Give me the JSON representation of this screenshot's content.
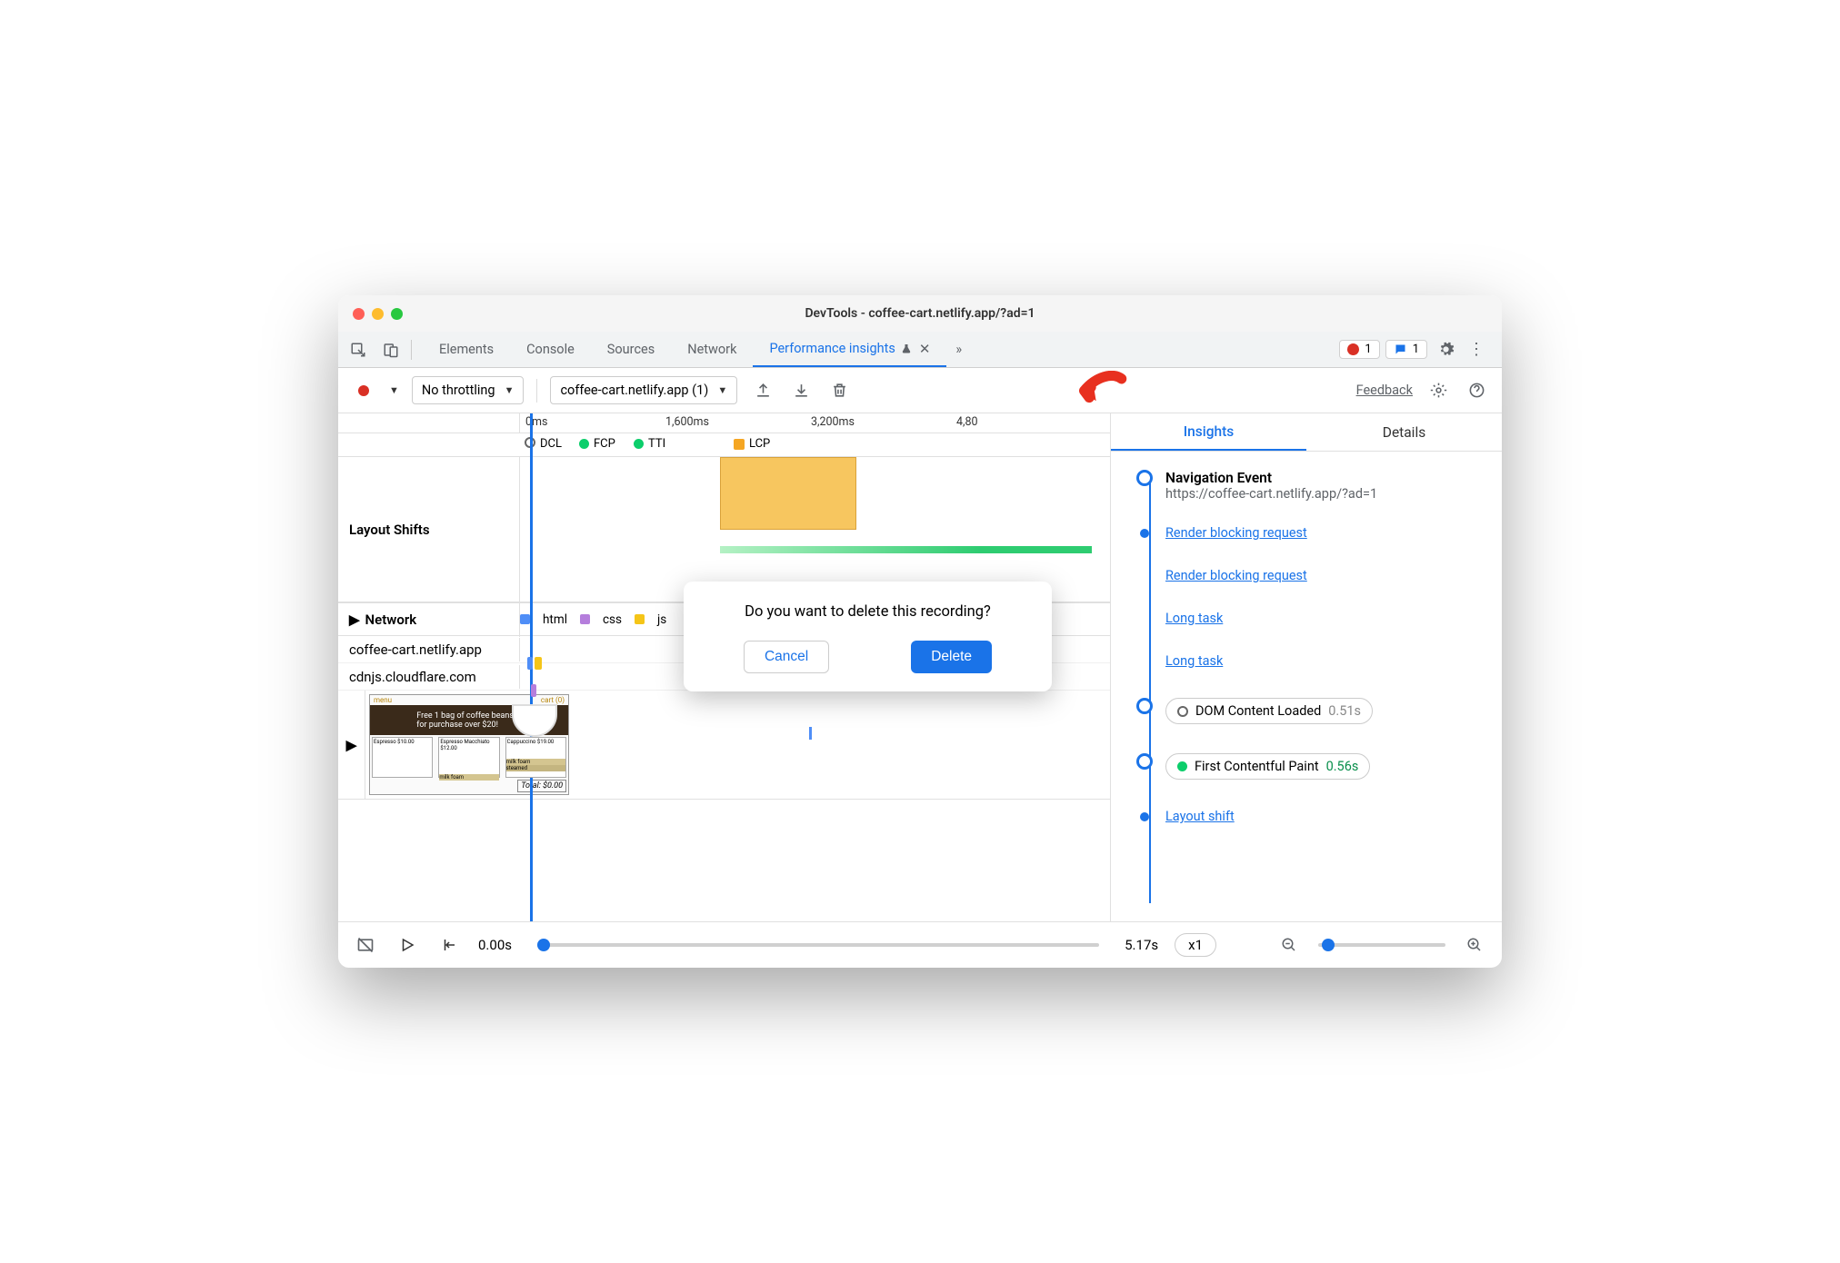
{
  "window": {
    "title": "DevTools - coffee-cart.netlify.app/?ad=1"
  },
  "tabs": {
    "items": [
      "Elements",
      "Console",
      "Sources",
      "Network",
      "Performance insights"
    ],
    "active_index": 4,
    "overflow_glyph": "»",
    "error_count": "1",
    "message_count": "1"
  },
  "toolbar": {
    "throttling": "No throttling",
    "recording": "coffee-cart.netlify.app (1)",
    "feedback": "Feedback"
  },
  "timeline": {
    "ruler": {
      "t0": "0ms",
      "t1": "1,600ms",
      "t2": "3,200ms",
      "t3": "4,80"
    },
    "markers": {
      "dcl": "DCL",
      "fcp": "FCP",
      "tti": "TTI",
      "lcp": "LCP"
    },
    "layout_shifts_label": "Layout Shifts",
    "network_label": "Network",
    "net_legend": {
      "html": "html",
      "css": "css",
      "js": "js"
    },
    "hosts": [
      "coffee-cart.netlify.app",
      "cdnjs.cloudflare.com"
    ]
  },
  "thumbnail": {
    "banner": "Free 1 bag of coffee beans for purchase over $20!",
    "nav": {
      "menu": "menu",
      "cart": "cart (0)"
    },
    "products": [
      "Espresso $10.00",
      "Espresso Macchiato $12.00",
      "Cappuccino $19.00"
    ],
    "tags": {
      "milkfoam": "milk foam",
      "steamed": "steamed"
    },
    "total": "Total: $0.00"
  },
  "right": {
    "tabs": {
      "insights": "Insights",
      "details": "Details"
    },
    "nav_event": {
      "title": "Navigation Event",
      "url": "https://coffee-cart.netlify.app/?ad=1"
    },
    "links": {
      "rbr1": "Render blocking request",
      "rbr2": "Render blocking request",
      "lt1": "Long task",
      "lt2": "Long task",
      "ls": "Layout shift"
    },
    "dcl": {
      "label": "DOM Content Loaded",
      "time": "0.51s"
    },
    "fcp": {
      "label": "First Contentful Paint",
      "time": "0.56s"
    }
  },
  "footer": {
    "start": "0.00s",
    "end": "5.17s",
    "speed": "x1"
  },
  "dialog": {
    "text": "Do you want to delete this recording?",
    "cancel": "Cancel",
    "delete": "Delete"
  }
}
